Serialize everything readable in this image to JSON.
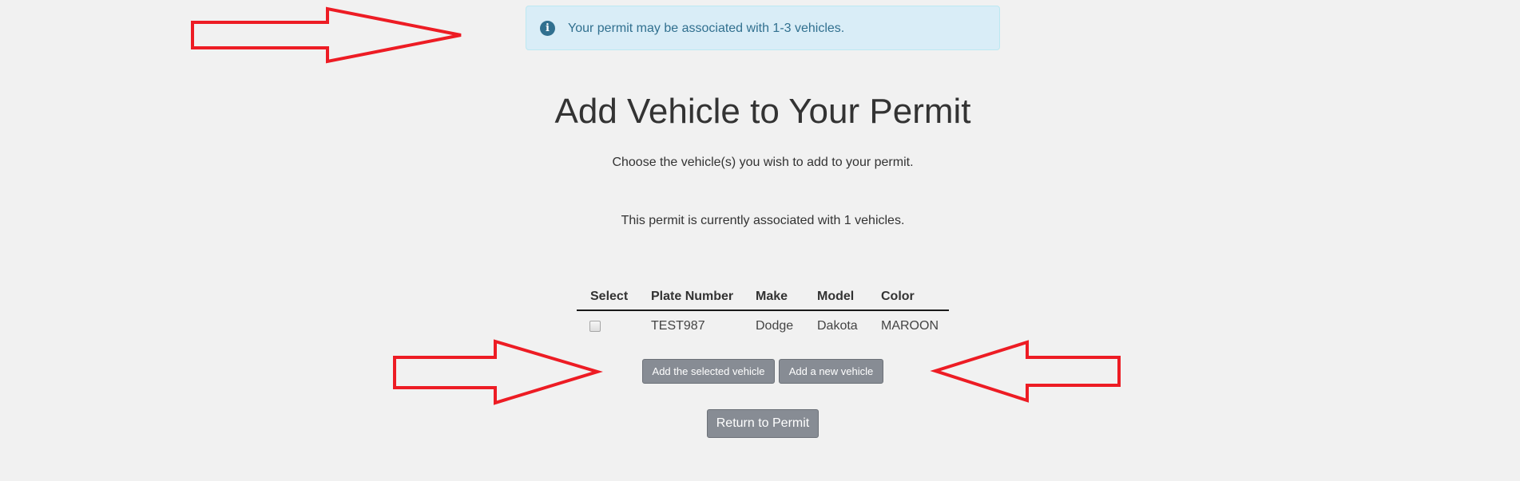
{
  "alert": {
    "icon": "info-circle-icon",
    "icon_glyph": "i",
    "text": "Your permit may be associated with 1-3 vehicles."
  },
  "page": {
    "title": "Add Vehicle to Your Permit",
    "instruction": "Choose the vehicle(s) you wish to add to your permit.",
    "association_status": "This permit is currently associated with 1 vehicles."
  },
  "table": {
    "headers": [
      "Select",
      "Plate Number",
      "Make",
      "Model",
      "Color"
    ],
    "rows": [
      {
        "selected": false,
        "plate_number": "TEST987",
        "make": "Dodge",
        "model": "Dakota",
        "color": "MAROON"
      }
    ]
  },
  "actions": {
    "add_selected_label": "Add the selected vehicle",
    "add_new_label": "Add a new vehicle",
    "return_label": "Return to Permit"
  },
  "annotations": {
    "arrow_color": "#ed1c24",
    "arrows": [
      {
        "direction": "right",
        "target": "alert"
      },
      {
        "direction": "right",
        "target": "add-selected-button"
      },
      {
        "direction": "left",
        "target": "add-new-button"
      }
    ]
  },
  "colors": {
    "background": "#f1f1f1",
    "alert_background": "#d9edf7",
    "alert_border": "#bce8f1",
    "alert_text": "#31708f",
    "button_background": "#878c94",
    "button_border": "#6c7178"
  }
}
